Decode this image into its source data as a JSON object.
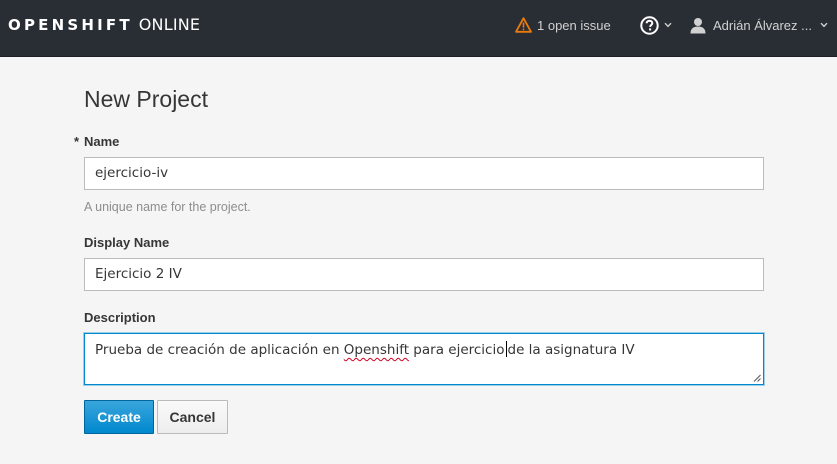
{
  "navbar": {
    "brand_bold": "OPENSHIFT",
    "brand_light": "ONLINE",
    "issues_label": "1 open issue",
    "help_icon": "question-circle-icon",
    "user_name": "Adrián Álvarez ...",
    "warning_color": "#ec7a08",
    "background_color": "#292e34"
  },
  "page": {
    "title": "New Project"
  },
  "form": {
    "required_marker": "*",
    "name": {
      "label": "Name",
      "value": "ejercicio-iv",
      "help": "A unique name for the project."
    },
    "display_name": {
      "label": "Display Name",
      "value": "Ejercicio 2 IV"
    },
    "description": {
      "label": "Description",
      "value_before_misspelled": "Prueba de creación de aplicación en ",
      "misspelled_word": "Openshift",
      "value_before_cursor": " para ejercicio",
      "value_after_cursor": "de la asignatura IV"
    }
  },
  "buttons": {
    "create": "Create",
    "cancel": "Cancel",
    "primary_color": "#0088ce"
  }
}
